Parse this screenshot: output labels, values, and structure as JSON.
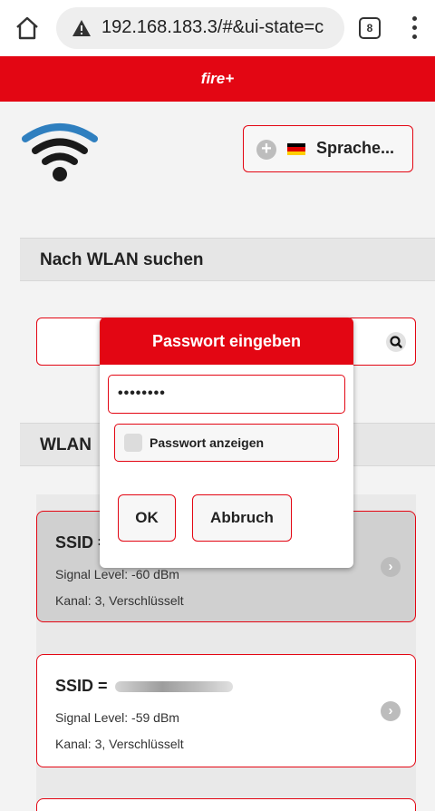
{
  "browser": {
    "url": "192.168.183.3/#&ui-state=c",
    "tab_count": "8"
  },
  "app": {
    "title": "fire+"
  },
  "language_button": {
    "label": "Sprache..."
  },
  "search_section": {
    "title": "Nach WLAN suchen"
  },
  "wlan_section": {
    "title": "WLAN"
  },
  "networks": [
    {
      "ssid_label": "SSID =",
      "signal": "Signal Level: -60 dBm",
      "channel": "Kanal: 3, Verschlüsselt"
    },
    {
      "ssid_label": "SSID =",
      "signal": "Signal Level: -59 dBm",
      "channel": "Kanal: 3, Verschlüsselt"
    }
  ],
  "dialog": {
    "title": "Passwort eingeben",
    "password_value": "••••••••",
    "show_password_label": "Passwort anzeigen",
    "ok_label": "OK",
    "cancel_label": "Abbruch"
  },
  "colors": {
    "accent": "#e30613",
    "background": "#f3f3f3"
  },
  "icons": [
    "home-icon",
    "warning-icon",
    "tabs-icon",
    "menu-icon",
    "wifi-logo",
    "plus-icon",
    "flag-icon",
    "search-icon",
    "chevron-right-icon"
  ]
}
